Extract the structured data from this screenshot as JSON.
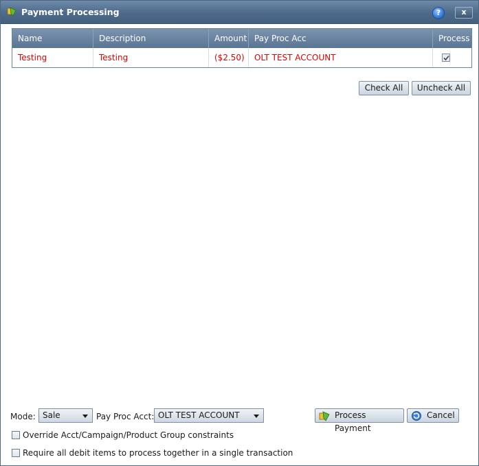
{
  "window": {
    "title": "Payment Processing",
    "help": "?",
    "close": "x"
  },
  "grid": {
    "headers": [
      "Name",
      "Description",
      "Amount",
      "Pay Proc Acc",
      "Process"
    ],
    "rows": [
      {
        "name": "Testing",
        "description": "Testing",
        "amount": "($2.50)",
        "pay_proc_acc": "OLT TEST ACCOUNT",
        "process": true
      }
    ]
  },
  "buttons": {
    "check_all": "Check All",
    "uncheck_all": "Uncheck All",
    "process_payment": "Process Payment",
    "cancel": "Cancel"
  },
  "footer": {
    "mode_label": "Mode:",
    "mode_value": "Sale",
    "pay_proc_acct_label": "Pay Proc Acct:",
    "pay_proc_acct_value": "OLT TEST ACCOUNT",
    "override_label": "Override Acct/Campaign/Product Group constraints",
    "override_checked": false,
    "require_label": "Require all debit items to process together in a single transaction",
    "require_checked": false
  },
  "colors": {
    "row_text": "#e00000",
    "header_bg": "#5a7594",
    "title_bg": "#4d6a8b"
  },
  "icons": {
    "title": "payment-icon",
    "process_payment": "payment-icon",
    "cancel": "cancel-icon"
  }
}
